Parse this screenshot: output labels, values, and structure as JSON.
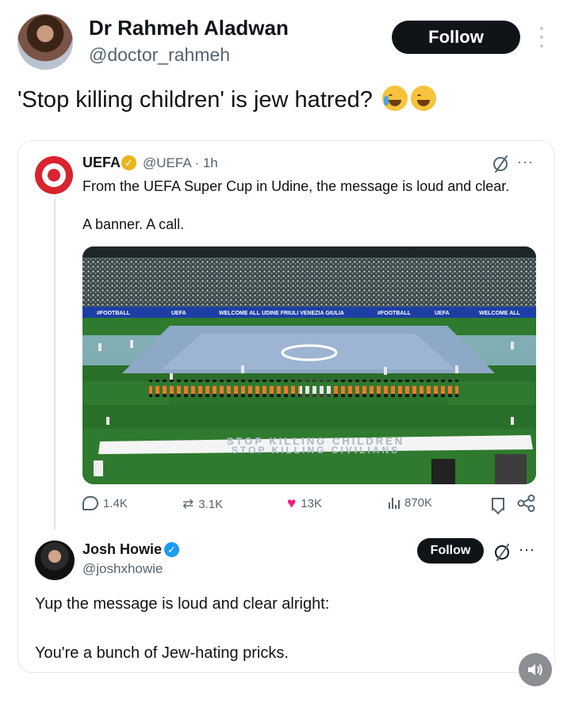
{
  "post": {
    "author_name": "Dr Rahmeh Aladwan",
    "author_handle": "@doctor_rahmeh",
    "follow_label": "Follow",
    "text": "'Stop killing children' is jew hatred?",
    "emojis": [
      "crying-emoji",
      "laughing-emoji"
    ]
  },
  "quoted": {
    "name": "UEFA",
    "meta": "@UEFA · 1h",
    "line1": "From the UEFA Super Cup in Udine, the message is loud and clear.",
    "line2": "A banner. A call.",
    "image": {
      "ad_boards": [
        "#FOOTBALL",
        "UEFA",
        "WELCOME ALL",
        "UDINE FRIULI VENEZIA GIULIA",
        "#FOOTBALL",
        "UEFA",
        "WELCOME ALL"
      ],
      "banner_line1": "STOP KILLING CHILDREN",
      "banner_line2": "STOP KILLING CIVILIANS"
    },
    "stats": {
      "replies": "1.4K",
      "reposts": "3.1K",
      "likes": "13K",
      "views": "870K"
    }
  },
  "reply": {
    "name": "Josh Howie",
    "handle": "@joshxhowie",
    "follow_label": "Follow",
    "line1": "Yup the message is loud and clear alright:",
    "line2": "You're a bunch of Jew-hating pricks."
  },
  "colors": {
    "text": "#0f1419",
    "secondary": "#536471",
    "like": "#f91880",
    "verified_gold": "#e8b51b",
    "verified_blue": "#1d9bf0",
    "uefa_red": "#d9232e"
  }
}
